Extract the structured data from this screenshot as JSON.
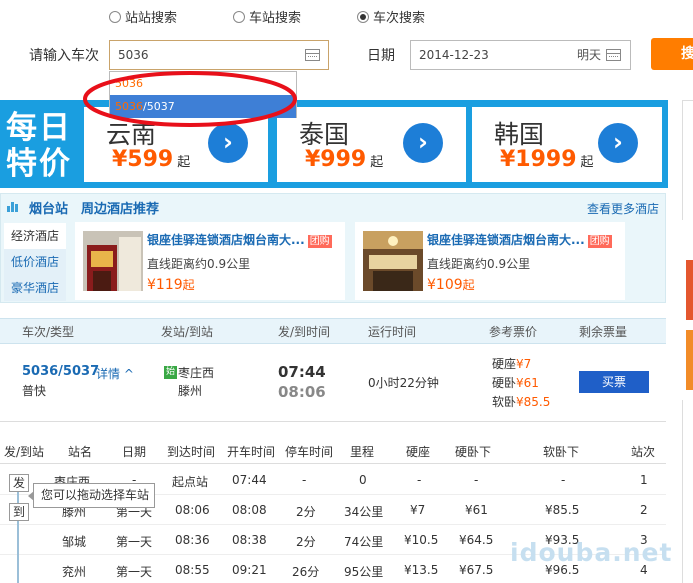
{
  "search_type": {
    "options": [
      {
        "label": "站站搜索",
        "selected": false
      },
      {
        "label": "车站搜索",
        "selected": false
      },
      {
        "label": "车次搜索",
        "selected": true
      }
    ]
  },
  "search": {
    "train_label": "请输入车次",
    "train_value": "5036",
    "date_label": "日期",
    "date_value": "2014-12-23",
    "date_hint": "明天",
    "button_label": "搜"
  },
  "suggestions": [
    {
      "prefix": "",
      "match": "5036",
      "rest": ""
    },
    {
      "prefix": "",
      "match": "5036",
      "rest": "/5037"
    }
  ],
  "banner": {
    "title_line1": "每日",
    "title_line2": "特价",
    "destinations": [
      {
        "name": "云南",
        "price": "¥599",
        "suffix": "起"
      },
      {
        "name": "泰国",
        "price": "¥999",
        "suffix": "起"
      },
      {
        "name": "韩国",
        "price": "¥1999",
        "suffix": "起"
      }
    ]
  },
  "hotel": {
    "station": "烟台站",
    "title": "周边酒店推荐",
    "more": "查看更多酒店",
    "tabs": [
      "经济酒店",
      "低价酒店",
      "豪华酒店"
    ],
    "cards": [
      {
        "name": "银座佳驿连锁酒店烟台南大...",
        "badge": "团购",
        "distance": "直线距离约0.9公里",
        "price": "¥119",
        "suffix": "起"
      },
      {
        "name": "银座佳驿连锁酒店烟台南大...",
        "badge": "团购",
        "distance": "直线距离约0.9公里",
        "price": "¥109",
        "suffix": "起"
      }
    ]
  },
  "results_header": {
    "col_train": "车次/类型",
    "col_station": "发站/到站",
    "col_time": "发/到时间",
    "col_duration": "运行时间",
    "col_price": "参考票价",
    "col_remaining": "剩余票量"
  },
  "result": {
    "train": "5036/5037",
    "detail": "详情",
    "type": "普快",
    "from_tag": "始",
    "from": "枣庄西",
    "to": "滕州",
    "depart": "07:44",
    "arrive": "08:06",
    "duration": "0小时22分钟",
    "prices": [
      {
        "seat": "硬座",
        "price": "¥7"
      },
      {
        "seat": "硬卧",
        "price": "¥61"
      },
      {
        "seat": "软卧",
        "price": "¥85.5"
      }
    ],
    "buy_label": "买票"
  },
  "stops_header": [
    "发/到站",
    "站名",
    "日期",
    "到达时间",
    "开车时间",
    "停车时间",
    "里程",
    "硬座",
    "硬卧下",
    "软卧下",
    "站次"
  ],
  "stops": [
    {
      "station": "枣庄西",
      "day": "-",
      "arrive": "起点站",
      "depart": "07:44",
      "stop": "-",
      "distance": "0",
      "seat": "-",
      "hard_sleeper": "-",
      "soft_sleeper": "-",
      "no": "1"
    },
    {
      "station": "滕州",
      "day": "第一天",
      "arrive": "08:06",
      "depart": "08:08",
      "stop": "2分",
      "distance": "34公里",
      "seat": "¥7",
      "hard_sleeper": "¥61",
      "soft_sleeper": "¥85.5",
      "no": "2"
    },
    {
      "station": "邹城",
      "day": "第一天",
      "arrive": "08:36",
      "depart": "08:38",
      "stop": "2分",
      "distance": "74公里",
      "seat": "¥10.5",
      "hard_sleeper": "¥64.5",
      "soft_sleeper": "¥93.5",
      "no": "3"
    },
    {
      "station": "兖州",
      "day": "第一天",
      "arrive": "08:55",
      "depart": "09:21",
      "stop": "26分",
      "distance": "95公里",
      "seat": "¥13.5",
      "hard_sleeper": "¥67.5",
      "soft_sleeper": "¥96.5",
      "no": "4"
    }
  ],
  "stop_markers": {
    "from": "发",
    "to": "到"
  },
  "tooltip": "您可以拖动选择车站",
  "watermark": "idouba.net",
  "colors": {
    "accent": "#ff5a00",
    "brand_blue": "#1a9ee0",
    "highlight_circle": "#e8101a"
  }
}
